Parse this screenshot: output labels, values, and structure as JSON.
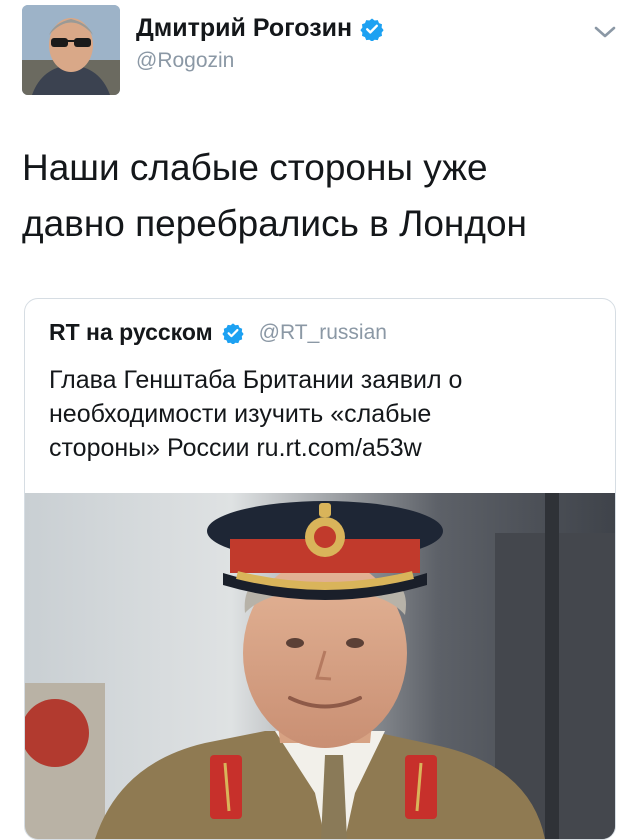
{
  "tweet": {
    "author_name": "Дмитрий Рогозин",
    "author_handle": "@Rogozin",
    "text_line1": "Наши слабые стороны уже",
    "text_line2": "давно перебрались в Лондон"
  },
  "quote": {
    "author_name": "RT на русском",
    "author_handle": "@RT_russian",
    "text_line1": "Глава Генштаба Британии заявил о",
    "text_line2": "необходимости изучить «слабые",
    "text_line3": "стороны» России ru.rt.com/a53w"
  },
  "icons": {
    "verified": "verified-badge-icon",
    "menu": "chevron-down-icon"
  },
  "colors": {
    "verified": "#1da1f2",
    "secondary_text": "#8b98a5",
    "primary_text": "#14171a",
    "card_border": "#d6dde3"
  }
}
